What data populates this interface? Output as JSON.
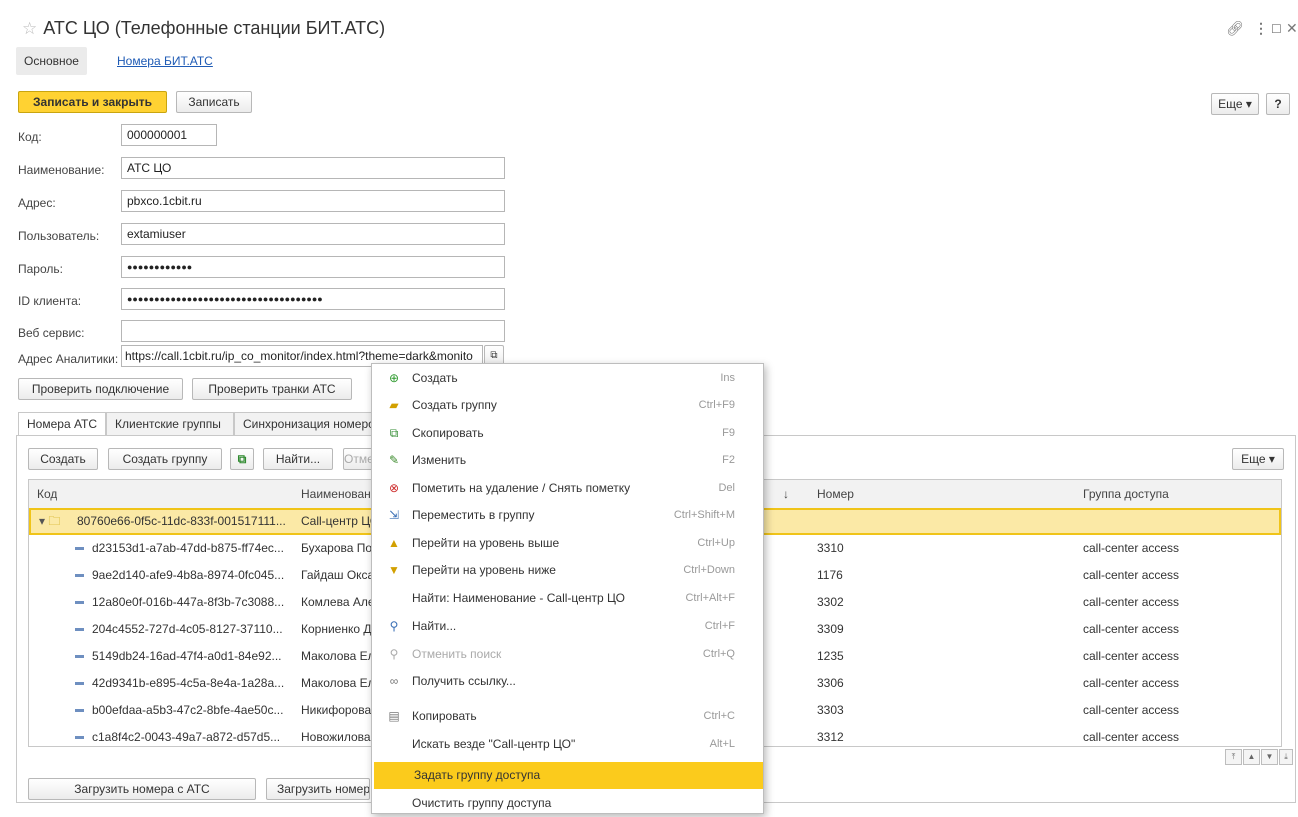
{
  "window": {
    "title": "АТС ЦО (Телефонные станции БИТ.АТС)"
  },
  "nav": {
    "main": "Основное",
    "numbers": "Номера БИТ.АТС"
  },
  "toolbar": {
    "save_close": "Записать и закрыть",
    "save": "Записать",
    "more": "Еще",
    "help": "?"
  },
  "form": {
    "code": {
      "label": "Код:",
      "value": "000000001"
    },
    "name": {
      "label": "Наименование:",
      "value": "АТС ЦО"
    },
    "address": {
      "label": "Адрес:",
      "value": "pbxco.1cbit.ru"
    },
    "user": {
      "label": "Пользователь:",
      "value": "extamiuser"
    },
    "password": {
      "label": "Пароль:",
      "value": "●●●●●●●●●●●●"
    },
    "client_id": {
      "label": "ID клиента:",
      "value": "●●●●●●●●●●●●●●●●●●●●●●●●●●●●●●●●●●●●"
    },
    "web_service": {
      "label": "Веб сервис:",
      "value": ""
    },
    "analytics": {
      "label": "Адрес Аналитики:",
      "value": "https://call.1cbit.ru/ip_co_monitor/index.html?theme=dark&monito"
    }
  },
  "actions": {
    "check_connection": "Проверить подключение",
    "check_trunks": "Проверить транки АТС"
  },
  "tabs": [
    "Номера АТС",
    "Клиентские группы",
    "Синхронизация номеров"
  ],
  "list_toolbar": {
    "create": "Создать",
    "create_group": "Создать группу",
    "find": "Найти...",
    "cancel": "Отменить поиск",
    "more": "Еще"
  },
  "table": {
    "columns": [
      "Код",
      "Наименование",
      "Номер",
      "Группа доступа"
    ],
    "group_row": {
      "code": "80760e66-0f5c-11dc-833f-001517111...",
      "name": "Call-центр ЦО"
    },
    "rows": [
      {
        "code": "d23153d1-a7ab-47dd-b875-ff74ec...",
        "name": "Бухарова Полина",
        "number": "3310",
        "group": "call-center access"
      },
      {
        "code": "9ae2d140-afe9-4b8a-8974-0fc045...",
        "name": "Гайдаш Оксана",
        "number": "1176",
        "group": "call-center access"
      },
      {
        "code": "12a80e0f-016b-447a-8f3b-7c3088...",
        "name": "Комлева Алена",
        "number": "3302",
        "group": "call-center access"
      },
      {
        "code": "204c4552-727d-4c05-8127-37110...",
        "name": "Корниенко Дарья",
        "number": "3309",
        "group": "call-center access"
      },
      {
        "code": "5149db24-16ad-47f4-a0d1-84e92...",
        "name": "Маколова Елена",
        "number": "1235",
        "group": "call-center access"
      },
      {
        "code": "42d9341b-e895-4c5a-8e4a-1a28a...",
        "name": "Маколова Елена",
        "number": "3306",
        "group": "call-center access"
      },
      {
        "code": "b00efdaa-a5b3-47c2-8bfe-4ae50c...",
        "name": "Никифорова Анна",
        "number": "3303",
        "group": "call-center access"
      },
      {
        "code": "c1a8f4c2-0043-49a7-a872-d57d5...",
        "name": "Новожилова Ольга",
        "number": "3312",
        "group": "call-center access"
      }
    ]
  },
  "bottom": {
    "load_numbers": "Загрузить номера с АТС",
    "load_numbers2": "Загрузить номера"
  },
  "context_menu": [
    {
      "label": "Создать",
      "shortcut": "Ins",
      "icon": "plus-circle-icon"
    },
    {
      "label": "Создать группу",
      "shortcut": "Ctrl+F9",
      "icon": "folder-add-icon"
    },
    {
      "label": "Скопировать",
      "shortcut": "F9",
      "icon": "copy-item-icon"
    },
    {
      "label": "Изменить",
      "shortcut": "F2",
      "icon": "pencil-icon"
    },
    {
      "label": "Пометить на удаление / Снять пометку",
      "shortcut": "Del",
      "icon": "delete-mark-icon"
    },
    {
      "label": "Переместить в группу",
      "shortcut": "Ctrl+Shift+M",
      "icon": "move-to-group-icon"
    },
    {
      "label": "Перейти на уровень выше",
      "shortcut": "Ctrl+Up",
      "icon": "level-up-icon"
    },
    {
      "label": "Перейти на уровень ниже",
      "shortcut": "Ctrl+Down",
      "icon": "level-down-icon"
    },
    {
      "label": "Найти: Наименование - Call-центр ЦО",
      "shortcut": "Ctrl+Alt+F",
      "icon": ""
    },
    {
      "label": "Найти...",
      "shortcut": "Ctrl+F",
      "icon": "search-icon"
    },
    {
      "label": "Отменить поиск",
      "shortcut": "Ctrl+Q",
      "icon": "cancel-search-icon"
    },
    {
      "label": "Получить ссылку...",
      "shortcut": "",
      "icon": "link-icon"
    },
    {
      "label": "Копировать",
      "shortcut": "Ctrl+C",
      "icon": "clipboard-icon"
    },
    {
      "label": "Искать везде \"Call-центр ЦО\"",
      "shortcut": "Alt+L",
      "icon": ""
    },
    {
      "label": "Задать группу доступа",
      "shortcut": "",
      "icon": ""
    },
    {
      "label": "Очистить группу доступа",
      "shortcut": "",
      "icon": ""
    }
  ],
  "colors": {
    "accent_yellow": "#ffd232",
    "link_blue": "#1f5bb5",
    "selection": "#fbe9a6"
  }
}
